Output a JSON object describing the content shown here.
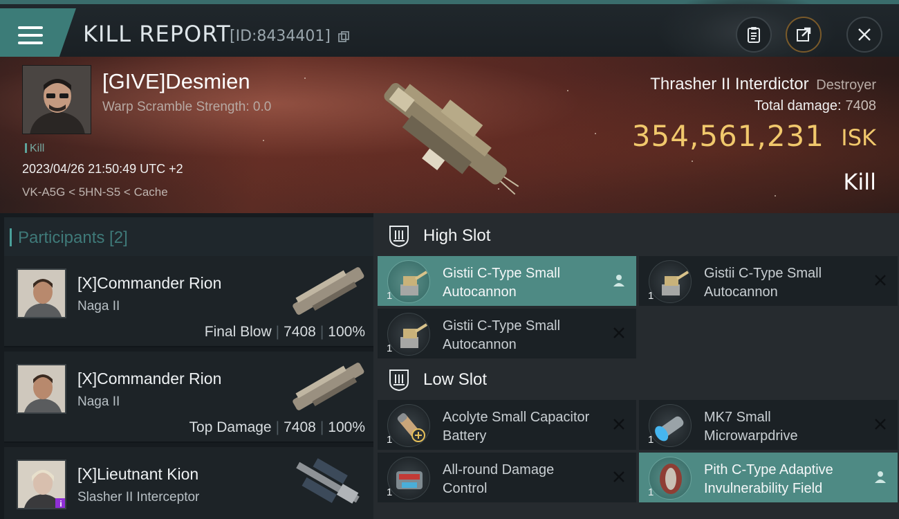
{
  "header": {
    "title": "KILL REPORT",
    "report_id": "[ID:8434401]",
    "menu_icon": "hamburger-menu-icon",
    "buttons": [
      "clipboard-icon",
      "share-icon",
      "close-icon"
    ]
  },
  "victim": {
    "name": "[GIVE]Desmien",
    "warp_scramble": "Warp Scramble Strength: 0.0",
    "tag": "Kill",
    "datetime": "2023/04/26 21:50:49 UTC +2",
    "location": "VK-A5G < 5HN-S5 < Cache",
    "ship_name": "Thrasher II Interdictor",
    "ship_class": "Destroyer",
    "total_damage_label": "Total damage:",
    "total_damage": "7408",
    "isk_value": "354,561,231",
    "isk_unit": "ISK",
    "outcome": "Kill"
  },
  "participants": {
    "header_label": "Participants [2]",
    "rows": [
      {
        "name": "[X]Commander Rion",
        "ship": "Naga II",
        "role": "Final Blow",
        "damage": "7408",
        "percent": "100%"
      },
      {
        "name": "[X]Commander Rion",
        "ship": "Naga II",
        "role": "Top Damage",
        "damage": "7408",
        "percent": "100%"
      },
      {
        "name": "[X]Lieutnant Kion",
        "ship": "Slasher II Interceptor",
        "badge": "i"
      }
    ]
  },
  "fitting": {
    "high_slot_label": "High Slot",
    "low_slot_label": "Low Slot",
    "high": [
      {
        "name": "Gistii C-Type Small Autocannon",
        "qty": "1",
        "state": "dropped",
        "highlight": true
      },
      {
        "name": "Gistii C-Type Small Autocannon",
        "qty": "1",
        "state": "destroyed"
      },
      {
        "name": "Gistii C-Type Small Autocannon",
        "qty": "1",
        "state": "destroyed"
      }
    ],
    "low": [
      {
        "name": "Acolyte Small Capacitor Battery",
        "qty": "1",
        "state": "destroyed"
      },
      {
        "name": "MK7 Small Microwarpdrive",
        "qty": "1",
        "state": "destroyed"
      },
      {
        "name": "All-round Damage Control",
        "qty": "1",
        "state": "destroyed"
      },
      {
        "name": "Pith C-Type Adaptive Invulnerability Field",
        "qty": "1",
        "state": "dropped",
        "highlight": true
      }
    ]
  },
  "colors": {
    "accent": "#4e8a84",
    "isk": "#f1c86c",
    "header_bar": "#3a6c6c"
  }
}
